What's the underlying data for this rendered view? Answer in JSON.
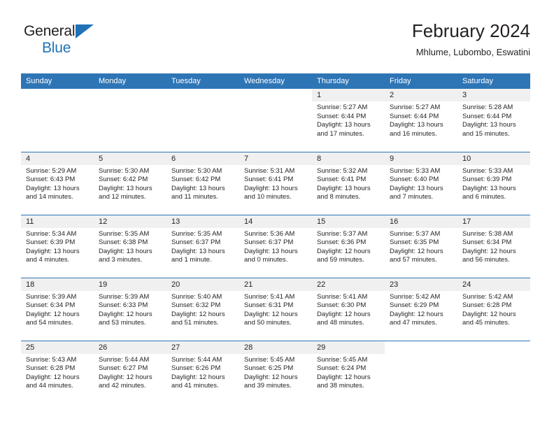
{
  "brand": {
    "line1": "General",
    "line2": "Blue",
    "triangle_color": "#1f72b8"
  },
  "header": {
    "title": "February 2024",
    "subtitle": "Mhlume, Lubombo, Eswatini"
  },
  "theme": {
    "header_blue": "#2e75b6",
    "daynum_gray": "#f0f0f0",
    "text": "#231f20"
  },
  "weekday_headers": [
    "Sunday",
    "Monday",
    "Tuesday",
    "Wednesday",
    "Thursday",
    "Friday",
    "Saturday"
  ],
  "labels": {
    "sunrise": "Sunrise:",
    "sunset": "Sunset:",
    "daylight": "Daylight:"
  },
  "weeks": [
    [
      {
        "day": "",
        "blank": true
      },
      {
        "day": "",
        "blank": true
      },
      {
        "day": "",
        "blank": true
      },
      {
        "day": "",
        "blank": true
      },
      {
        "day": "1",
        "sunrise": "Sunrise: 5:27 AM",
        "sunset": "Sunset: 6:44 PM",
        "daylight1": "Daylight: 13 hours",
        "daylight2": "and 17 minutes."
      },
      {
        "day": "2",
        "sunrise": "Sunrise: 5:27 AM",
        "sunset": "Sunset: 6:44 PM",
        "daylight1": "Daylight: 13 hours",
        "daylight2": "and 16 minutes."
      },
      {
        "day": "3",
        "sunrise": "Sunrise: 5:28 AM",
        "sunset": "Sunset: 6:44 PM",
        "daylight1": "Daylight: 13 hours",
        "daylight2": "and 15 minutes."
      }
    ],
    [
      {
        "day": "4",
        "sunrise": "Sunrise: 5:29 AM",
        "sunset": "Sunset: 6:43 PM",
        "daylight1": "Daylight: 13 hours",
        "daylight2": "and 14 minutes."
      },
      {
        "day": "5",
        "sunrise": "Sunrise: 5:30 AM",
        "sunset": "Sunset: 6:42 PM",
        "daylight1": "Daylight: 13 hours",
        "daylight2": "and 12 minutes."
      },
      {
        "day": "6",
        "sunrise": "Sunrise: 5:30 AM",
        "sunset": "Sunset: 6:42 PM",
        "daylight1": "Daylight: 13 hours",
        "daylight2": "and 11 minutes."
      },
      {
        "day": "7",
        "sunrise": "Sunrise: 5:31 AM",
        "sunset": "Sunset: 6:41 PM",
        "daylight1": "Daylight: 13 hours",
        "daylight2": "and 10 minutes."
      },
      {
        "day": "8",
        "sunrise": "Sunrise: 5:32 AM",
        "sunset": "Sunset: 6:41 PM",
        "daylight1": "Daylight: 13 hours",
        "daylight2": "and 8 minutes."
      },
      {
        "day": "9",
        "sunrise": "Sunrise: 5:33 AM",
        "sunset": "Sunset: 6:40 PM",
        "daylight1": "Daylight: 13 hours",
        "daylight2": "and 7 minutes."
      },
      {
        "day": "10",
        "sunrise": "Sunrise: 5:33 AM",
        "sunset": "Sunset: 6:39 PM",
        "daylight1": "Daylight: 13 hours",
        "daylight2": "and 6 minutes."
      }
    ],
    [
      {
        "day": "11",
        "sunrise": "Sunrise: 5:34 AM",
        "sunset": "Sunset: 6:39 PM",
        "daylight1": "Daylight: 13 hours",
        "daylight2": "and 4 minutes."
      },
      {
        "day": "12",
        "sunrise": "Sunrise: 5:35 AM",
        "sunset": "Sunset: 6:38 PM",
        "daylight1": "Daylight: 13 hours",
        "daylight2": "and 3 minutes."
      },
      {
        "day": "13",
        "sunrise": "Sunrise: 5:35 AM",
        "sunset": "Sunset: 6:37 PM",
        "daylight1": "Daylight: 13 hours",
        "daylight2": "and 1 minute."
      },
      {
        "day": "14",
        "sunrise": "Sunrise: 5:36 AM",
        "sunset": "Sunset: 6:37 PM",
        "daylight1": "Daylight: 13 hours",
        "daylight2": "and 0 minutes."
      },
      {
        "day": "15",
        "sunrise": "Sunrise: 5:37 AM",
        "sunset": "Sunset: 6:36 PM",
        "daylight1": "Daylight: 12 hours",
        "daylight2": "and 59 minutes."
      },
      {
        "day": "16",
        "sunrise": "Sunrise: 5:37 AM",
        "sunset": "Sunset: 6:35 PM",
        "daylight1": "Daylight: 12 hours",
        "daylight2": "and 57 minutes."
      },
      {
        "day": "17",
        "sunrise": "Sunrise: 5:38 AM",
        "sunset": "Sunset: 6:34 PM",
        "daylight1": "Daylight: 12 hours",
        "daylight2": "and 56 minutes."
      }
    ],
    [
      {
        "day": "18",
        "sunrise": "Sunrise: 5:39 AM",
        "sunset": "Sunset: 6:34 PM",
        "daylight1": "Daylight: 12 hours",
        "daylight2": "and 54 minutes."
      },
      {
        "day": "19",
        "sunrise": "Sunrise: 5:39 AM",
        "sunset": "Sunset: 6:33 PM",
        "daylight1": "Daylight: 12 hours",
        "daylight2": "and 53 minutes."
      },
      {
        "day": "20",
        "sunrise": "Sunrise: 5:40 AM",
        "sunset": "Sunset: 6:32 PM",
        "daylight1": "Daylight: 12 hours",
        "daylight2": "and 51 minutes."
      },
      {
        "day": "21",
        "sunrise": "Sunrise: 5:41 AM",
        "sunset": "Sunset: 6:31 PM",
        "daylight1": "Daylight: 12 hours",
        "daylight2": "and 50 minutes."
      },
      {
        "day": "22",
        "sunrise": "Sunrise: 5:41 AM",
        "sunset": "Sunset: 6:30 PM",
        "daylight1": "Daylight: 12 hours",
        "daylight2": "and 48 minutes."
      },
      {
        "day": "23",
        "sunrise": "Sunrise: 5:42 AM",
        "sunset": "Sunset: 6:29 PM",
        "daylight1": "Daylight: 12 hours",
        "daylight2": "and 47 minutes."
      },
      {
        "day": "24",
        "sunrise": "Sunrise: 5:42 AM",
        "sunset": "Sunset: 6:28 PM",
        "daylight1": "Daylight: 12 hours",
        "daylight2": "and 45 minutes."
      }
    ],
    [
      {
        "day": "25",
        "sunrise": "Sunrise: 5:43 AM",
        "sunset": "Sunset: 6:28 PM",
        "daylight1": "Daylight: 12 hours",
        "daylight2": "and 44 minutes."
      },
      {
        "day": "26",
        "sunrise": "Sunrise: 5:44 AM",
        "sunset": "Sunset: 6:27 PM",
        "daylight1": "Daylight: 12 hours",
        "daylight2": "and 42 minutes."
      },
      {
        "day": "27",
        "sunrise": "Sunrise: 5:44 AM",
        "sunset": "Sunset: 6:26 PM",
        "daylight1": "Daylight: 12 hours",
        "daylight2": "and 41 minutes."
      },
      {
        "day": "28",
        "sunrise": "Sunrise: 5:45 AM",
        "sunset": "Sunset: 6:25 PM",
        "daylight1": "Daylight: 12 hours",
        "daylight2": "and 39 minutes."
      },
      {
        "day": "29",
        "sunrise": "Sunrise: 5:45 AM",
        "sunset": "Sunset: 6:24 PM",
        "daylight1": "Daylight: 12 hours",
        "daylight2": "and 38 minutes."
      },
      {
        "day": "",
        "blank": true
      },
      {
        "day": "",
        "blank": true
      }
    ]
  ]
}
